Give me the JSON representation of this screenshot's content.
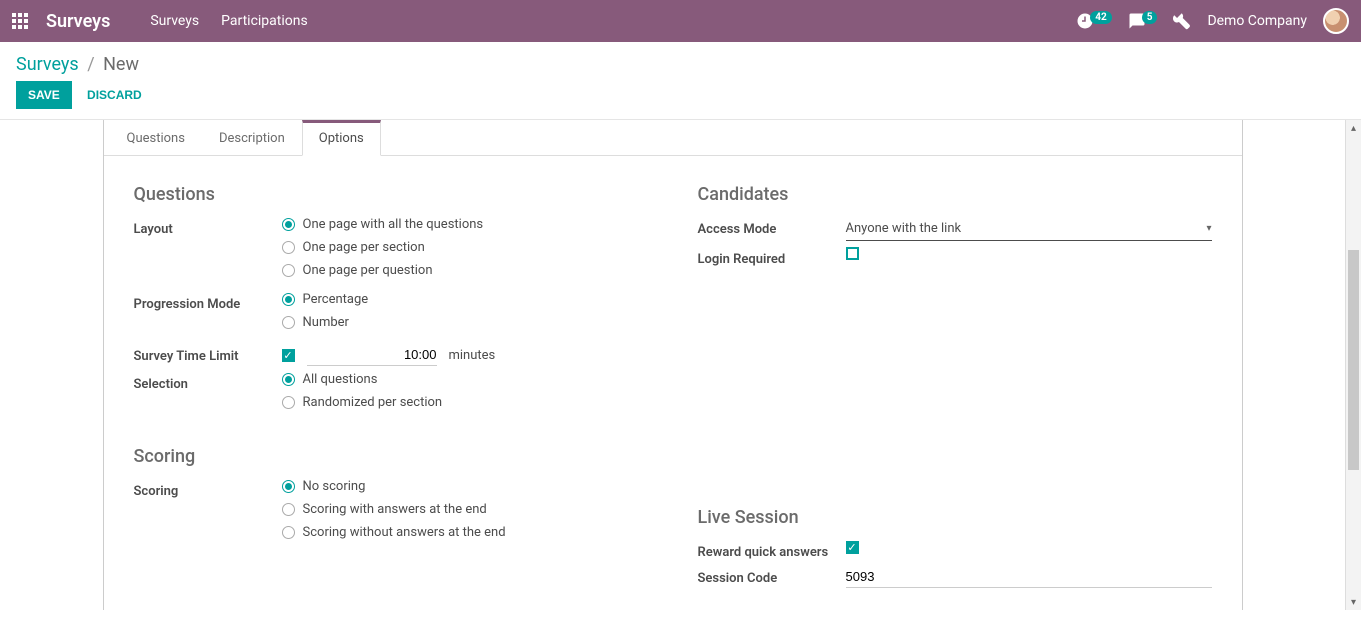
{
  "navbar": {
    "brand": "Surveys",
    "links": [
      "Surveys",
      "Participations"
    ],
    "activity_count": "42",
    "chat_count": "5",
    "company": "Demo Company"
  },
  "breadcrumb": {
    "root": "Surveys",
    "current": "New"
  },
  "actions": {
    "save": "SAVE",
    "discard": "DISCARD"
  },
  "tabs": [
    "Questions",
    "Description",
    "Options"
  ],
  "active_tab": 2,
  "sections": {
    "questions": {
      "title": "Questions",
      "layout": {
        "label": "Layout",
        "options": [
          "One page with all the questions",
          "One page per section",
          "One page per question"
        ],
        "selected": 0
      },
      "progression": {
        "label": "Progression Mode",
        "options": [
          "Percentage",
          "Number"
        ],
        "selected": 0
      },
      "time_limit": {
        "label": "Survey Time Limit",
        "enabled": true,
        "value": "10:00",
        "unit": "minutes"
      },
      "selection": {
        "label": "Selection",
        "options": [
          "All questions",
          "Randomized per section"
        ],
        "selected": 0
      }
    },
    "candidates": {
      "title": "Candidates",
      "access_mode": {
        "label": "Access Mode",
        "value": "Anyone with the link"
      },
      "login_required": {
        "label": "Login Required",
        "checked": false
      }
    },
    "scoring": {
      "title": "Scoring",
      "label": "Scoring",
      "options": [
        "No scoring",
        "Scoring with answers at the end",
        "Scoring without answers at the end"
      ],
      "selected": 0
    },
    "live": {
      "title": "Live Session",
      "reward": {
        "label": "Reward quick answers",
        "checked": true
      },
      "code": {
        "label": "Session Code",
        "value": "5093"
      }
    }
  }
}
